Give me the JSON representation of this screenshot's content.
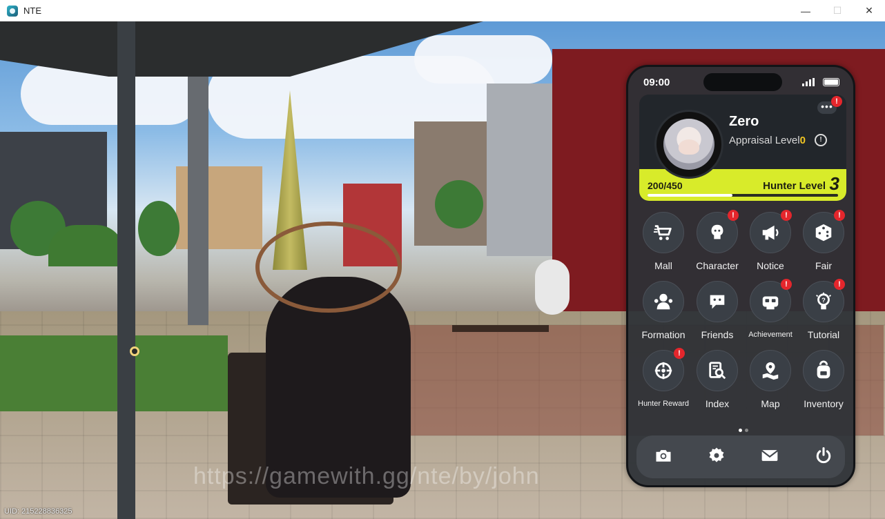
{
  "window": {
    "title": "NTE",
    "controls": [
      "—",
      "☐",
      "✕"
    ]
  },
  "phone": {
    "status_time": "09:00",
    "profile": {
      "name": "Zero",
      "appraisal_label": "Appraisal Level",
      "appraisal_level": "0",
      "more_button": "•••",
      "more_badge": "!"
    },
    "hunter": {
      "xp_text": "200/450",
      "level_label": "Hunter Level",
      "level_value": "3",
      "xp_current": 200,
      "xp_max": 450
    },
    "apps": [
      {
        "label": "Mall",
        "icon": "cart-icon",
        "badge": ""
      },
      {
        "label": "Character",
        "icon": "character-icon",
        "badge": "!"
      },
      {
        "label": "Notice",
        "icon": "megaphone-icon",
        "badge": "!"
      },
      {
        "label": "Fair",
        "icon": "dice-icon",
        "badge": "!"
      },
      {
        "label": "Formation",
        "icon": "formation-icon",
        "badge": ""
      },
      {
        "label": "Friends",
        "icon": "chat-bubble-icon",
        "badge": ""
      },
      {
        "label": "Achievement",
        "icon": "achievement-icon",
        "badge": "!"
      },
      {
        "label": "Tutorial",
        "icon": "lightbulb-icon",
        "badge": "!"
      },
      {
        "label": "Hunter Reward",
        "icon": "crosshair-icon",
        "badge": "!"
      },
      {
        "label": "Index",
        "icon": "index-search-icon",
        "badge": ""
      },
      {
        "label": "Map",
        "icon": "map-pin-icon",
        "badge": ""
      },
      {
        "label": "Inventory",
        "icon": "backpack-icon",
        "badge": ""
      }
    ],
    "page_indicator": {
      "current": 1,
      "total": 2
    },
    "dock": [
      {
        "icon": "camera-icon"
      },
      {
        "icon": "settings-gear-icon"
      },
      {
        "icon": "mail-icon"
      },
      {
        "icon": "power-icon"
      }
    ]
  },
  "overlay": {
    "watermark": "https://gamewith.gg/nte/by/john",
    "uid": "UID: 215228836325"
  }
}
